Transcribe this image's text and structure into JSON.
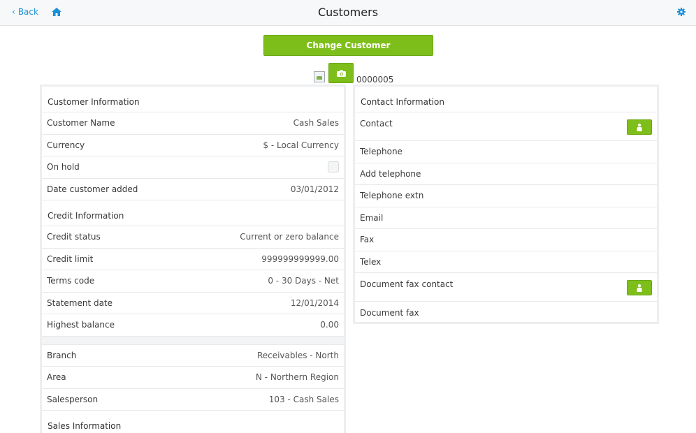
{
  "header": {
    "back_label": "Back",
    "title": "Customers",
    "icons": {
      "back": "chevron-left-icon",
      "home": "home-icon",
      "settings": "gear-icon"
    },
    "accent": "#1a8fd6"
  },
  "change_customer_label": "Change Customer",
  "customer_code": "0000005",
  "colors": {
    "button_green": "#7ebe1a"
  },
  "customer_info": {
    "heading": "Customer Information",
    "rows": [
      {
        "label": "Customer Name",
        "value": "Cash Sales"
      },
      {
        "label": "Currency",
        "value": "$ - Local Currency"
      },
      {
        "label": "On hold",
        "value": "",
        "checked": false
      },
      {
        "label": "Date customer added",
        "value": "03/01/2012"
      }
    ]
  },
  "credit_info": {
    "heading": "Credit Information",
    "rows": [
      {
        "label": "Credit status",
        "value": "Current or zero balance"
      },
      {
        "label": "Credit limit",
        "value": "999999999999.00"
      },
      {
        "label": "Terms code",
        "value": "0 - 30 Days - Net"
      },
      {
        "label": "Statement date",
        "value": "12/01/2014"
      },
      {
        "label": "Highest balance",
        "value": "0.00"
      }
    ]
  },
  "branch_info": {
    "rows": [
      {
        "label": "Branch",
        "value": "Receivables - North"
      },
      {
        "label": "Area",
        "value": "N - Northern Region"
      },
      {
        "label": "Salesperson",
        "value": "103 - Cash Sales"
      }
    ]
  },
  "sales_info": {
    "heading": "Sales Information"
  },
  "contact_info": {
    "heading": "Contact Information",
    "rows": [
      {
        "label": "Contact",
        "has_button": true
      },
      {
        "label": "Telephone"
      },
      {
        "label": "Add telephone"
      },
      {
        "label": "Telephone extn"
      },
      {
        "label": "Email"
      },
      {
        "label": "Fax"
      },
      {
        "label": "Telex"
      },
      {
        "label": "Document fax contact",
        "has_button": true
      },
      {
        "label": "Document fax"
      }
    ]
  }
}
